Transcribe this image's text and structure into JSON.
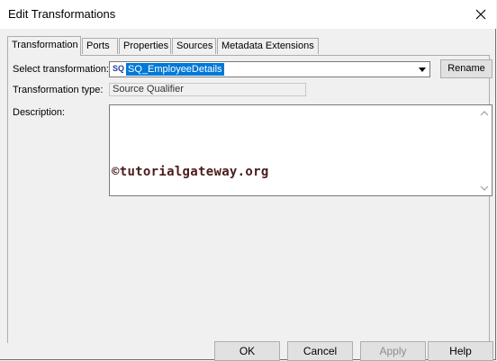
{
  "window": {
    "title": "Edit Transformations"
  },
  "tabs": [
    {
      "label": "Transformation",
      "active": true
    },
    {
      "label": "Ports",
      "active": false
    },
    {
      "label": "Properties",
      "active": false
    },
    {
      "label": "Sources",
      "active": false
    },
    {
      "label": "Metadata Extensions",
      "active": false
    }
  ],
  "form": {
    "select_transformation_label": "Select transformation:",
    "select_transformation_icon": "SQ",
    "select_transformation_value": "SQ_EmployeeDetails",
    "rename_label": "Rename",
    "transformation_type_label": "Transformation type:",
    "transformation_type_value": "Source Qualifier",
    "description_label": "Description:",
    "description_value": ""
  },
  "watermark": "©tutorialgateway.org",
  "buttons": {
    "ok": "OK",
    "cancel": "Cancel",
    "apply": "Apply",
    "help": "Help"
  },
  "colors": {
    "selection": "#0078d7",
    "watermark": "#4a1c1c"
  }
}
